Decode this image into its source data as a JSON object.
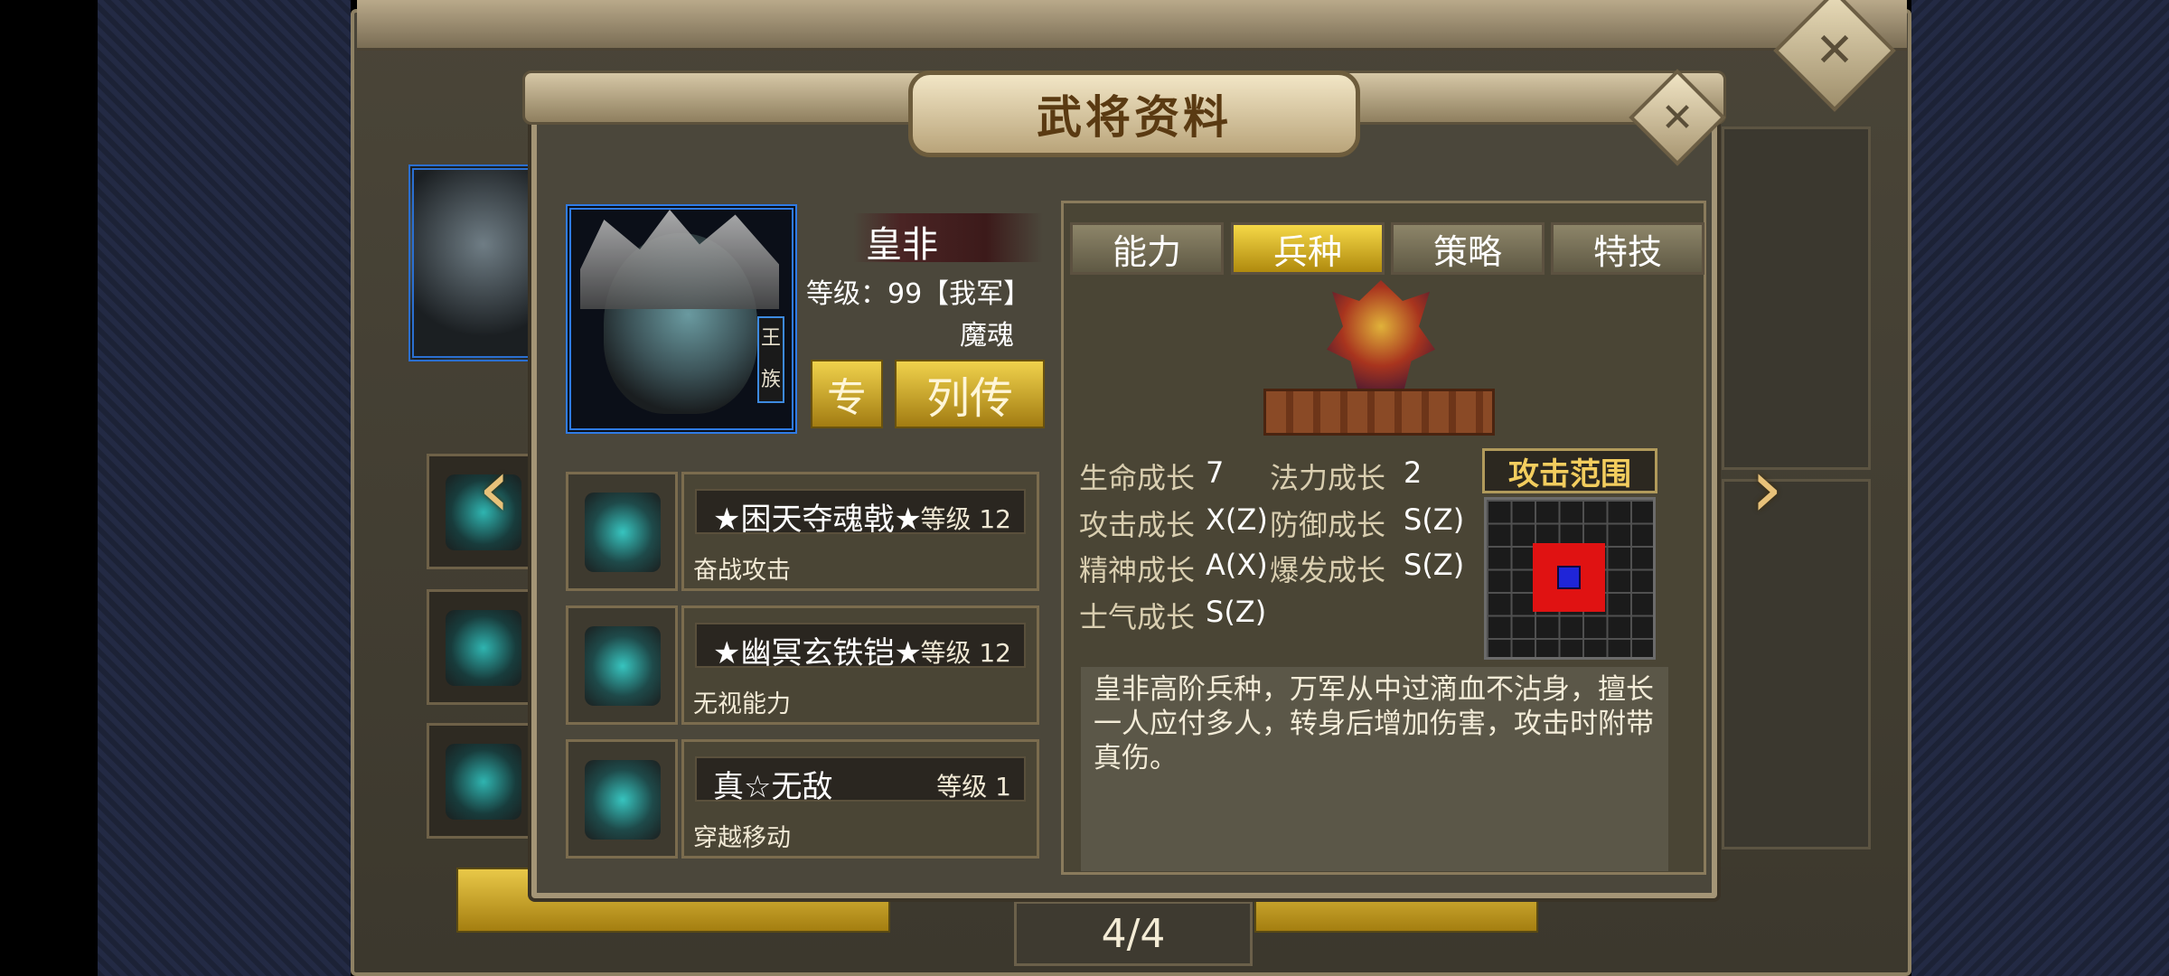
{
  "dialog": {
    "title": "武将资料",
    "close_label": "✕"
  },
  "background": {
    "close_label": "✕",
    "pager": "4/4",
    "left_arrow": "‹",
    "right_arrow": "›"
  },
  "general": {
    "name": "皇非",
    "level_text": "等级：99【我军】",
    "soul": "魔魂",
    "clan_badge": "王族",
    "buttons": {
      "zhuan": "专",
      "liezhuan": "列传"
    }
  },
  "skills": [
    {
      "name": "★困天夺魂戟★",
      "level": "等级 12",
      "desc": "奋战攻击",
      "icon": "halberd-icon"
    },
    {
      "name": "★幽冥玄铁铠★",
      "level": "等级 12",
      "desc": "无视能力",
      "icon": "armor-icon"
    },
    {
      "name": "真☆无敌",
      "level": "等级 1",
      "desc": "穿越移动",
      "icon": "scroll-icon"
    }
  ],
  "tabs": [
    {
      "label": "能力",
      "active": false
    },
    {
      "label": "兵种",
      "active": true
    },
    {
      "label": "策略",
      "active": false
    },
    {
      "label": "特技",
      "active": false
    }
  ],
  "stats": {
    "hp_label": "生命成长",
    "hp_value": "7",
    "mp_label": "法力成长",
    "mp_value": "2",
    "atk_label": "攻击成长",
    "atk_value": "X(Z)",
    "def_label": "防御成长",
    "def_value": "S(Z)",
    "spi_label": "精神成长",
    "spi_value": "A(X)",
    "burst_label": "爆发成长",
    "burst_value": "S(Z)",
    "morale_label": "士气成长",
    "morale_value": "S(Z)"
  },
  "attack_range": {
    "title": "攻击范围"
  },
  "unit_description": "皇非高阶兵种，万军从中过滴血不沾身，擅长一人应付多人，转身后增加伤害，攻击时附带真伤。",
  "colors": {
    "active_tab": "#f5d847",
    "portrait_border": "#2f7be6",
    "range_attack": "#e01212",
    "range_center": "#1f25d8"
  }
}
